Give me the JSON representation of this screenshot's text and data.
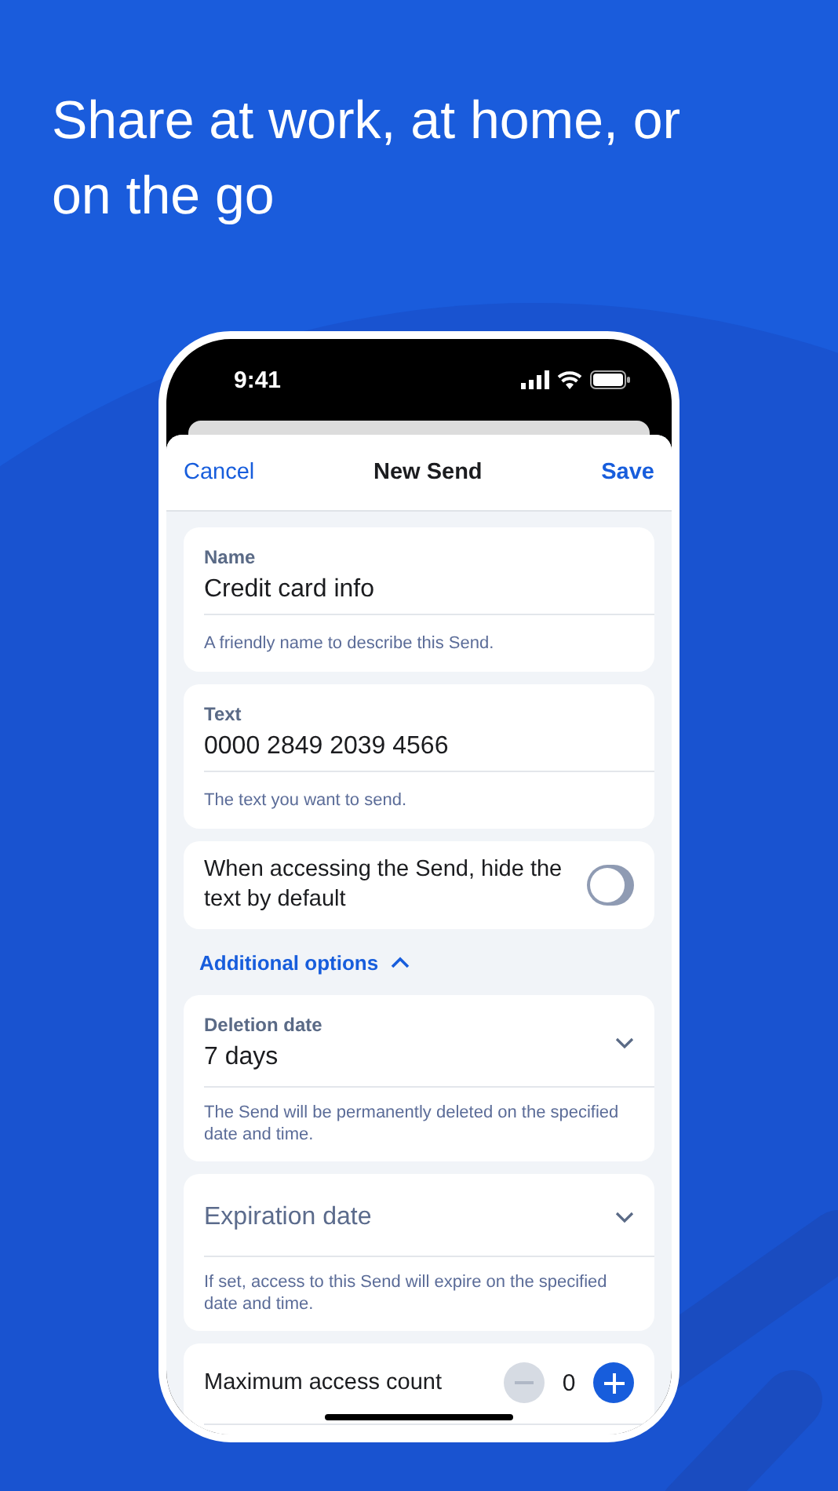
{
  "headline": "Share at work, at home, or on the go",
  "status_bar": {
    "time": "9:41"
  },
  "nav": {
    "cancel": "Cancel",
    "title": "New Send",
    "save": "Save"
  },
  "cards": [
    {
      "kind": "text",
      "label": "Name",
      "value": "Credit card info",
      "hint": "A friendly name to describe this Send."
    },
    {
      "kind": "text",
      "label": "Text",
      "value": "0000 2849 2039 4566",
      "hint": "The text you want to send."
    },
    {
      "kind": "toggle",
      "label": "When accessing the Send, hide the text by default",
      "on": false
    },
    {
      "kind": "section",
      "label": "Additional options",
      "expanded": true
    },
    {
      "kind": "select",
      "label": "Deletion date",
      "value": "7 days",
      "hint": "The Send will be permanently deleted on the specified date and time."
    },
    {
      "kind": "select",
      "placeholder": "Expiration date",
      "hint": "If set, access to this Send will expire on the specified date and time."
    },
    {
      "kind": "counter",
      "label": "Maximum access count",
      "value": "0",
      "decrement_disabled": true
    }
  ]
}
